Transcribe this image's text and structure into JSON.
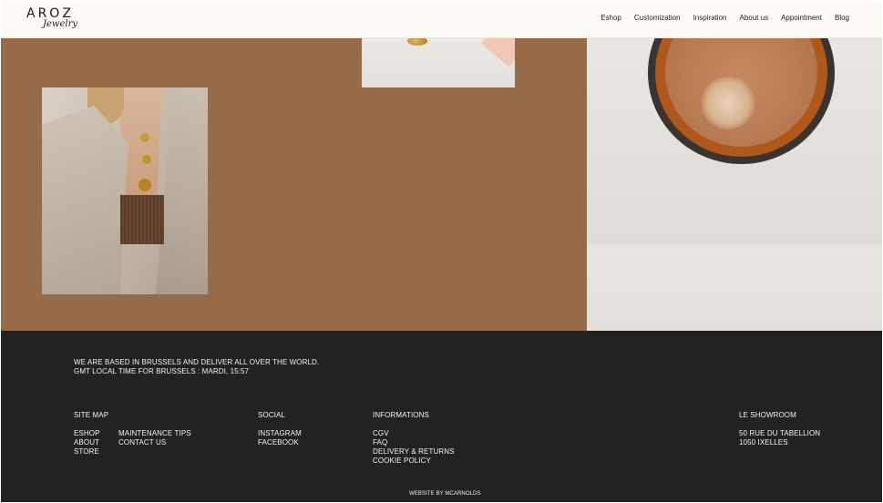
{
  "header": {
    "logo_main": "AROZ",
    "logo_sub": "Jewelry",
    "nav": [
      "Eshop",
      "Customization",
      "Inspiration",
      "About us",
      "Appointment",
      "Blog"
    ]
  },
  "footer": {
    "intro_line1": "WE ARE BASED IN BRUSSELS AND DELIVER ALL OVER THE WORLD.",
    "intro_line2": "GMT LOCAL TIME FOR BRUSSELS : MARDI, 15:57",
    "sitemap": {
      "title": "SITE MAP",
      "col1": [
        "ESHOP",
        "ABOUT",
        "STORE"
      ],
      "col2": [
        "MAINTENANCE TIPS",
        "CONTACT US"
      ]
    },
    "social": {
      "title": "SOCIAL",
      "links": [
        "INSTAGRAM",
        "FACEBOOK"
      ]
    },
    "informations": {
      "title": "INFORMATIONS",
      "links": [
        "CGV",
        "FAQ",
        "DELIVERY & RETURNS",
        "COOKIE POLICY"
      ]
    },
    "showroom": {
      "title": "LE SHOWROOM",
      "address_line1": "50 RUE DU TABELLION",
      "address_line2": "1050 IXELLES"
    },
    "credit": "WEBSITE BY MCARNOLDS"
  },
  "colors": {
    "brown_panel": "#976a48",
    "footer_bg": "#222222",
    "header_bg": "#fdfaf6"
  }
}
